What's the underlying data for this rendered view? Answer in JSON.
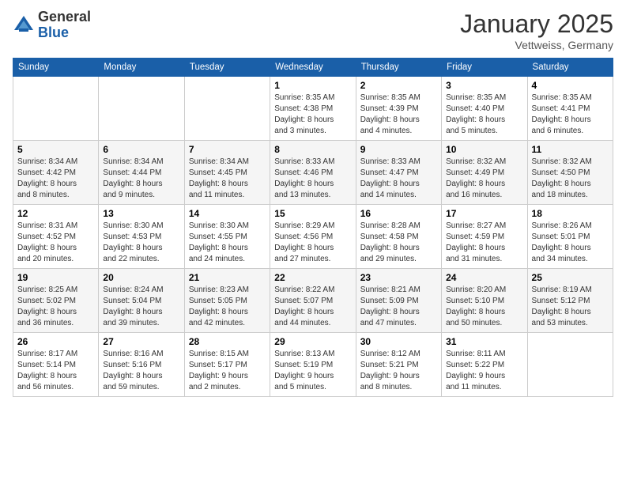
{
  "header": {
    "logo_general": "General",
    "logo_blue": "Blue",
    "month_title": "January 2025",
    "location": "Vettweiss, Germany"
  },
  "days_of_week": [
    "Sunday",
    "Monday",
    "Tuesday",
    "Wednesday",
    "Thursday",
    "Friday",
    "Saturday"
  ],
  "weeks": [
    [
      {
        "day": "",
        "info": ""
      },
      {
        "day": "",
        "info": ""
      },
      {
        "day": "",
        "info": ""
      },
      {
        "day": "1",
        "info": "Sunrise: 8:35 AM\nSunset: 4:38 PM\nDaylight: 8 hours\nand 3 minutes."
      },
      {
        "day": "2",
        "info": "Sunrise: 8:35 AM\nSunset: 4:39 PM\nDaylight: 8 hours\nand 4 minutes."
      },
      {
        "day": "3",
        "info": "Sunrise: 8:35 AM\nSunset: 4:40 PM\nDaylight: 8 hours\nand 5 minutes."
      },
      {
        "day": "4",
        "info": "Sunrise: 8:35 AM\nSunset: 4:41 PM\nDaylight: 8 hours\nand 6 minutes."
      }
    ],
    [
      {
        "day": "5",
        "info": "Sunrise: 8:34 AM\nSunset: 4:42 PM\nDaylight: 8 hours\nand 8 minutes."
      },
      {
        "day": "6",
        "info": "Sunrise: 8:34 AM\nSunset: 4:44 PM\nDaylight: 8 hours\nand 9 minutes."
      },
      {
        "day": "7",
        "info": "Sunrise: 8:34 AM\nSunset: 4:45 PM\nDaylight: 8 hours\nand 11 minutes."
      },
      {
        "day": "8",
        "info": "Sunrise: 8:33 AM\nSunset: 4:46 PM\nDaylight: 8 hours\nand 13 minutes."
      },
      {
        "day": "9",
        "info": "Sunrise: 8:33 AM\nSunset: 4:47 PM\nDaylight: 8 hours\nand 14 minutes."
      },
      {
        "day": "10",
        "info": "Sunrise: 8:32 AM\nSunset: 4:49 PM\nDaylight: 8 hours\nand 16 minutes."
      },
      {
        "day": "11",
        "info": "Sunrise: 8:32 AM\nSunset: 4:50 PM\nDaylight: 8 hours\nand 18 minutes."
      }
    ],
    [
      {
        "day": "12",
        "info": "Sunrise: 8:31 AM\nSunset: 4:52 PM\nDaylight: 8 hours\nand 20 minutes."
      },
      {
        "day": "13",
        "info": "Sunrise: 8:30 AM\nSunset: 4:53 PM\nDaylight: 8 hours\nand 22 minutes."
      },
      {
        "day": "14",
        "info": "Sunrise: 8:30 AM\nSunset: 4:55 PM\nDaylight: 8 hours\nand 24 minutes."
      },
      {
        "day": "15",
        "info": "Sunrise: 8:29 AM\nSunset: 4:56 PM\nDaylight: 8 hours\nand 27 minutes."
      },
      {
        "day": "16",
        "info": "Sunrise: 8:28 AM\nSunset: 4:58 PM\nDaylight: 8 hours\nand 29 minutes."
      },
      {
        "day": "17",
        "info": "Sunrise: 8:27 AM\nSunset: 4:59 PM\nDaylight: 8 hours\nand 31 minutes."
      },
      {
        "day": "18",
        "info": "Sunrise: 8:26 AM\nSunset: 5:01 PM\nDaylight: 8 hours\nand 34 minutes."
      }
    ],
    [
      {
        "day": "19",
        "info": "Sunrise: 8:25 AM\nSunset: 5:02 PM\nDaylight: 8 hours\nand 36 minutes."
      },
      {
        "day": "20",
        "info": "Sunrise: 8:24 AM\nSunset: 5:04 PM\nDaylight: 8 hours\nand 39 minutes."
      },
      {
        "day": "21",
        "info": "Sunrise: 8:23 AM\nSunset: 5:05 PM\nDaylight: 8 hours\nand 42 minutes."
      },
      {
        "day": "22",
        "info": "Sunrise: 8:22 AM\nSunset: 5:07 PM\nDaylight: 8 hours\nand 44 minutes."
      },
      {
        "day": "23",
        "info": "Sunrise: 8:21 AM\nSunset: 5:09 PM\nDaylight: 8 hours\nand 47 minutes."
      },
      {
        "day": "24",
        "info": "Sunrise: 8:20 AM\nSunset: 5:10 PM\nDaylight: 8 hours\nand 50 minutes."
      },
      {
        "day": "25",
        "info": "Sunrise: 8:19 AM\nSunset: 5:12 PM\nDaylight: 8 hours\nand 53 minutes."
      }
    ],
    [
      {
        "day": "26",
        "info": "Sunrise: 8:17 AM\nSunset: 5:14 PM\nDaylight: 8 hours\nand 56 minutes."
      },
      {
        "day": "27",
        "info": "Sunrise: 8:16 AM\nSunset: 5:16 PM\nDaylight: 8 hours\nand 59 minutes."
      },
      {
        "day": "28",
        "info": "Sunrise: 8:15 AM\nSunset: 5:17 PM\nDaylight: 9 hours\nand 2 minutes."
      },
      {
        "day": "29",
        "info": "Sunrise: 8:13 AM\nSunset: 5:19 PM\nDaylight: 9 hours\nand 5 minutes."
      },
      {
        "day": "30",
        "info": "Sunrise: 8:12 AM\nSunset: 5:21 PM\nDaylight: 9 hours\nand 8 minutes."
      },
      {
        "day": "31",
        "info": "Sunrise: 8:11 AM\nSunset: 5:22 PM\nDaylight: 9 hours\nand 11 minutes."
      },
      {
        "day": "",
        "info": ""
      }
    ]
  ]
}
